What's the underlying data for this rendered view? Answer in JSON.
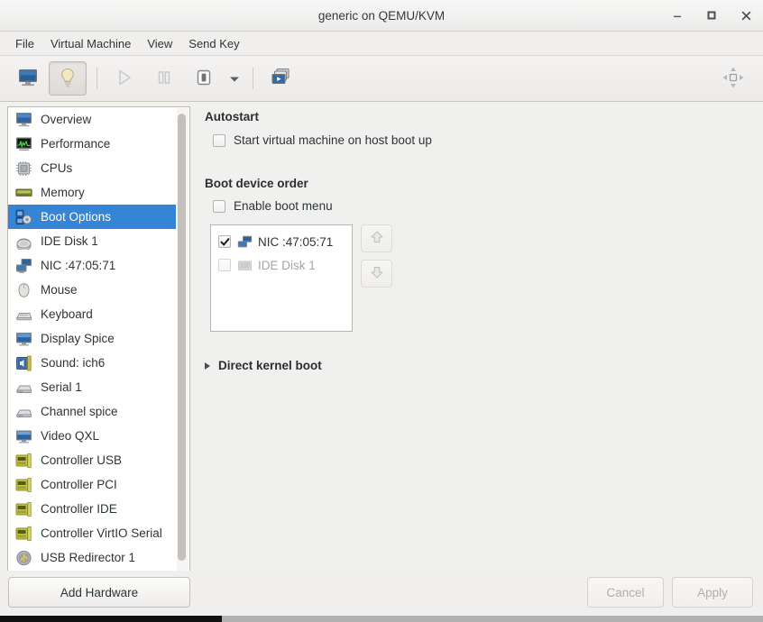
{
  "window": {
    "title": "generic on QEMU/KVM",
    "controls": [
      {
        "name": "minimize-button",
        "glyph": "minimize"
      },
      {
        "name": "maximize-button",
        "glyph": "maximize"
      },
      {
        "name": "close-button",
        "glyph": "close"
      }
    ]
  },
  "menubar": {
    "items": [
      {
        "label": "File"
      },
      {
        "label": "Virtual Machine"
      },
      {
        "label": "View"
      },
      {
        "label": "Send Key"
      }
    ]
  },
  "toolbar": {
    "buttons": [
      {
        "name": "show-console-button",
        "icon": "monitor-icon",
        "state": "normal"
      },
      {
        "name": "show-details-button",
        "icon": "lightbulb-icon",
        "state": "toggled"
      },
      {
        "name": "run-button",
        "icon": "play-icon",
        "state": "disabled"
      },
      {
        "name": "pause-button",
        "icon": "pause-icon",
        "state": "disabled"
      },
      {
        "name": "shutdown-button",
        "icon": "power-icon",
        "state": "normal"
      },
      {
        "name": "shutdown-menu-caret",
        "icon": "chevron-down-icon",
        "state": "normal"
      },
      {
        "name": "snapshots-button",
        "icon": "snapshots-icon",
        "state": "normal"
      }
    ],
    "fullscreen": {
      "name": "fullscreen-button",
      "icon": "expand-arrows-icon"
    }
  },
  "sidebar": {
    "items": [
      {
        "label": "Overview",
        "icon": "monitor-icon",
        "selected": false
      },
      {
        "label": "Performance",
        "icon": "performance-graph-icon",
        "selected": false
      },
      {
        "label": "CPUs",
        "icon": "cpu-chip-icon",
        "selected": false
      },
      {
        "label": "Memory",
        "icon": "memory-stick-icon",
        "selected": false
      },
      {
        "label": "Boot Options",
        "icon": "boot-options-icon",
        "selected": true
      },
      {
        "label": "IDE Disk 1",
        "icon": "hard-disk-icon",
        "selected": false
      },
      {
        "label": "NIC :47:05:71",
        "icon": "network-card-icon",
        "selected": false
      },
      {
        "label": "Mouse",
        "icon": "mouse-icon",
        "selected": false
      },
      {
        "label": "Keyboard",
        "icon": "keyboard-icon",
        "selected": false
      },
      {
        "label": "Display Spice",
        "icon": "display-icon",
        "selected": false
      },
      {
        "label": "Sound: ich6",
        "icon": "sound-card-icon",
        "selected": false
      },
      {
        "label": "Serial 1",
        "icon": "serial-port-icon",
        "selected": false
      },
      {
        "label": "Channel spice",
        "icon": "channel-icon",
        "selected": false
      },
      {
        "label": "Video QXL",
        "icon": "video-card-icon",
        "selected": false
      },
      {
        "label": "Controller USB",
        "icon": "controller-icon",
        "selected": false
      },
      {
        "label": "Controller PCI",
        "icon": "controller-icon",
        "selected": false
      },
      {
        "label": "Controller IDE",
        "icon": "controller-icon",
        "selected": false
      },
      {
        "label": "Controller VirtIO Serial",
        "icon": "controller-icon",
        "selected": false
      },
      {
        "label": "USB Redirector 1",
        "icon": "usb-icon",
        "selected": false
      }
    ],
    "selection_color": "#3584d6"
  },
  "panel": {
    "autostart": {
      "heading": "Autostart",
      "checkbox": {
        "label": "Start virtual machine on host boot up",
        "checked": false
      }
    },
    "boot_order": {
      "heading": "Boot device order",
      "boot_menu": {
        "label": "Enable boot menu",
        "checked": false
      },
      "devices": [
        {
          "label": "NIC :47:05:71",
          "checked": true,
          "enabled": true,
          "icon": "network-card-icon"
        },
        {
          "label": "IDE Disk 1",
          "checked": false,
          "enabled": false,
          "icon": "hard-disk-icon"
        }
      ],
      "move_up": {
        "name": "move-up-button",
        "icon": "arrow-up-icon",
        "enabled": false
      },
      "move_down": {
        "name": "move-down-button",
        "icon": "arrow-down-icon",
        "enabled": false
      }
    },
    "direct_kernel_boot": {
      "label": "Direct kernel boot",
      "expanded": false
    }
  },
  "footer": {
    "add_hardware": "Add Hardware",
    "cancel": "Cancel",
    "apply": "Apply",
    "cancel_enabled": false,
    "apply_enabled": false
  }
}
